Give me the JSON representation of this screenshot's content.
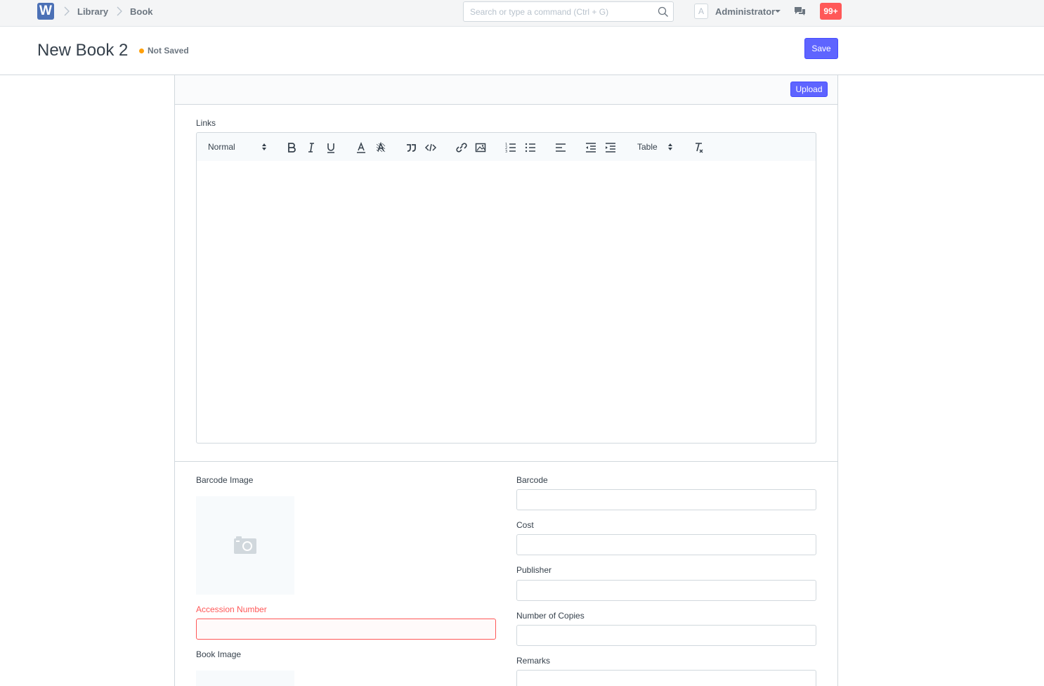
{
  "navbar": {
    "logo_letter": "W",
    "breadcrumbs": [
      "Library",
      "Book"
    ],
    "search_placeholder": "Search or type a command (Ctrl + G)",
    "avatar_letter": "A",
    "user_name": "Administrator",
    "notification_count": "99+"
  },
  "page": {
    "title": "New Book 2",
    "status": "Not Saved",
    "save_label": "Save"
  },
  "form": {
    "upload_label": "Upload",
    "links_label": "Links",
    "toolbar": {
      "header_select": "Normal",
      "table_select": "Table"
    },
    "barcode_image_label": "Barcode Image",
    "accession_number_label": "Accession Number",
    "book_image_label": "Book Image",
    "barcode_label": "Barcode",
    "cost_label": "Cost",
    "publisher_label": "Publisher",
    "copies_label": "Number of Copies",
    "remarks_label": "Remarks"
  },
  "colors": {
    "primary": "#5e64ff",
    "danger": "#ff5858",
    "indicator": "#ffa00a"
  }
}
